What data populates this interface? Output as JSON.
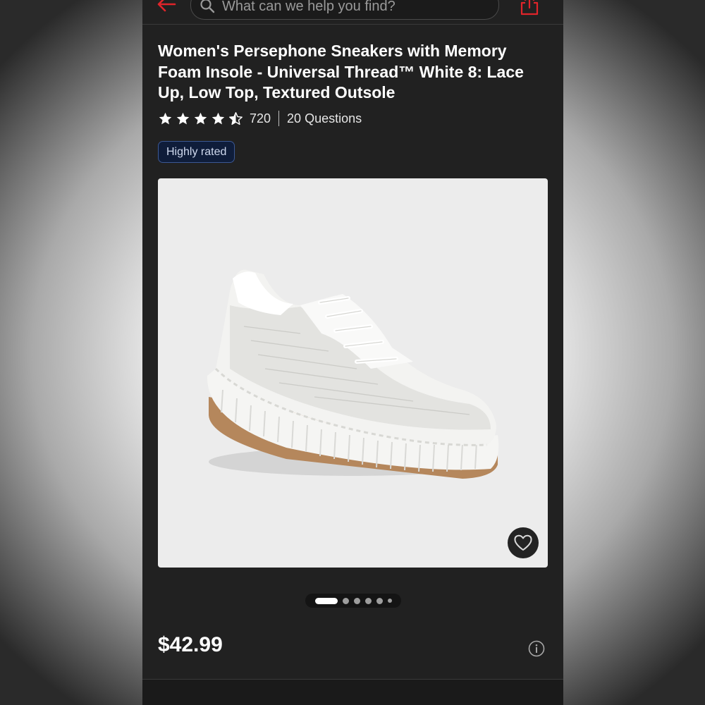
{
  "header": {
    "search_placeholder": "What can we help you find?",
    "back_icon": "arrow-left-icon",
    "share_icon": "share-icon",
    "accent_color": "#cc0000"
  },
  "product": {
    "title": "Women's Persephone Sneakers with Memory Foam Insole - Universal Thread™ White 8: Lace Up, Low Top, Textured Outsole",
    "rating": 4.5,
    "review_count": "720",
    "questions_label": "20 Questions",
    "badge": "Highly rated",
    "price": "$42.99"
  },
  "gallery": {
    "image_count": 6,
    "active_index": 0,
    "favorite_icon": "heart-icon",
    "info_icon": "info-icon"
  }
}
